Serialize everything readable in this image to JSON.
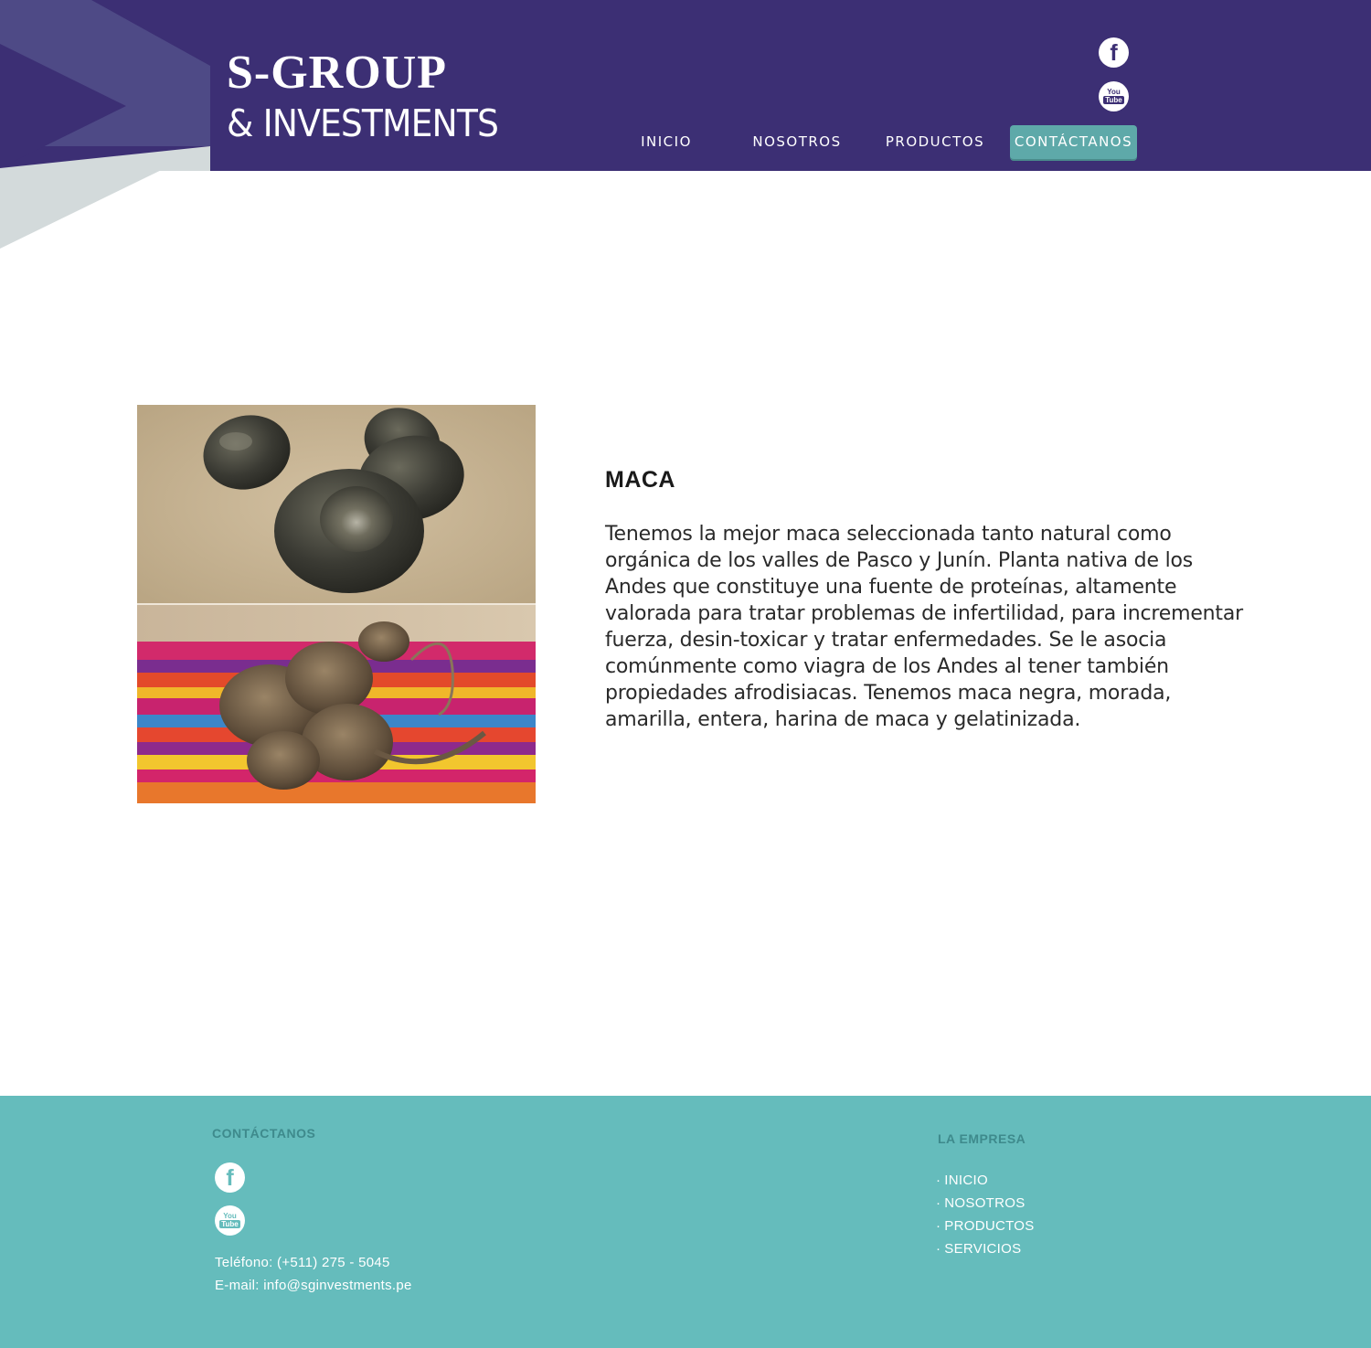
{
  "header": {
    "logo": {
      "line1": "S-GROUP",
      "line2": "& INVESTMENTS"
    },
    "social": [
      {
        "name": "facebook",
        "icon": "facebook-icon"
      },
      {
        "name": "youtube",
        "icon": "youtube-icon"
      }
    ],
    "nav": {
      "inicio": "INICIO",
      "nosotros": "NOSOTROS",
      "productos": "PRODUCTOS",
      "contactanos": "CONTÁCTANOS"
    },
    "colors": {
      "background": "#3c2f74",
      "active_nav": "#5ea9a9"
    }
  },
  "product": {
    "title": "MACA",
    "description": "Tenemos la mejor maca seleccionada tanto natural como orgánica de los valles de Pasco y Junín. Planta nativa de los Andes que constituye una fuente de proteínas, altamente valorada para tratar problemas de infertilidad, para incrementar fuerza, desin-toxicar y tratar enfermedades. Se le asocia comúnmente como viagra de los Andes al tener también propiedades afrodisiacas. Tenemos maca negra, morada, amarilla, entera, harina de maca y gelatinizada."
  },
  "footer": {
    "contact_heading": "CONTÁCTANOS",
    "phone": "Teléfono: (+511) 275 - 5045",
    "email": "E-mail: info@sginvestments.pe",
    "company_heading": "LA EMPRESA",
    "links": [
      "INICIO",
      "NOSOTROS",
      "PRODUCTOS",
      "SERVICIOS"
    ],
    "colors": {
      "background": "#65bcbc",
      "heading": "#3e8a8c"
    }
  }
}
